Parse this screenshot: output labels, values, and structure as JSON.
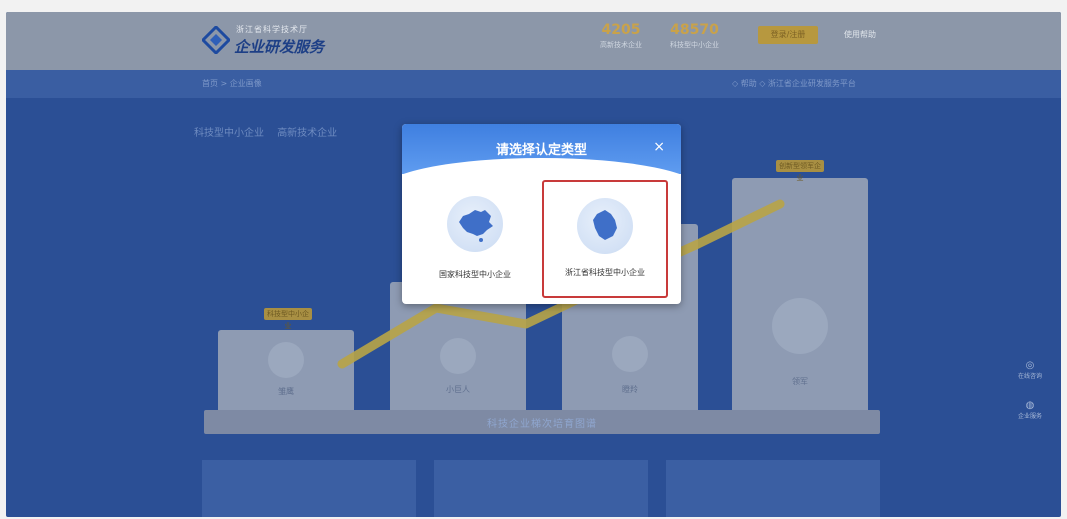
{
  "header": {
    "org_small": "浙江省科学技术厅",
    "org_big": "企业研发服务",
    "stats": [
      {
        "value": "4205",
        "label": "高新技术企业"
      },
      {
        "value": "48570",
        "label": "科技型中小企业"
      }
    ],
    "gold_button": "登录/注册",
    "link": "使用帮助"
  },
  "subbar": {
    "breadcrumb": "首页 > 企业画像",
    "right": "◇ 帮助 ◇ 浙江省企业研发服务平台"
  },
  "tabs": [
    "科技型中小企业",
    "高新技术企业"
  ],
  "stages": [
    {
      "label": "雏鹰",
      "gold_tag": "科技型中小企业",
      "note": ""
    },
    {
      "label": "小巨人",
      "gold_tag": "",
      "note": ""
    },
    {
      "label": "瞪羚",
      "gold_tag": "",
      "note": ""
    },
    {
      "label": "领军",
      "gold_tag": "创新型领军企业",
      "note": ""
    }
  ],
  "platform_label": "科技企业梯次培育图谱",
  "side_tools": [
    "在线咨询",
    "企业服务"
  ],
  "modal": {
    "title": "请选择认定类型",
    "close": "×",
    "options": [
      {
        "label": "国家科技型中小企业",
        "selected": false
      },
      {
        "label": "浙江省科技型中小企业",
        "selected": true
      }
    ]
  },
  "colors": {
    "accent": "#3f7fe0",
    "selection": "#c83a3a",
    "map_fill": "#3f6fc8"
  }
}
